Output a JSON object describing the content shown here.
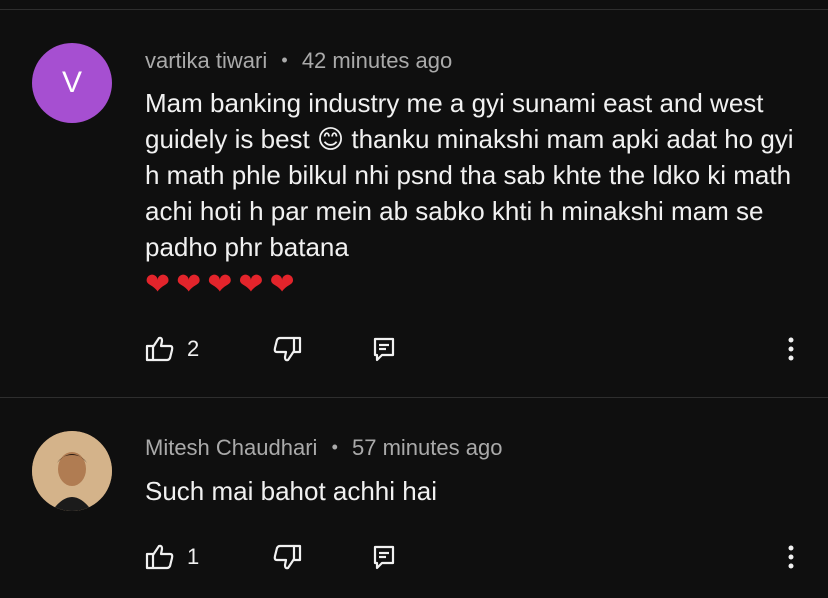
{
  "comments": [
    {
      "avatar_letter": "V",
      "author": "vartika tiwari",
      "separator": "•",
      "time": "42 minutes ago",
      "text_part1": "Mam banking industry me a gyi sunami east and west guidely is best",
      "emoji": "😊",
      "text_part2": "thanku minakshi mam apki adat ho gyi h math phle bilkul nhi psnd tha sab khte the ldko ki math achi hoti h par mein ab sabko khti h minakshi mam se padho phr batana",
      "hearts": "❤❤❤❤❤",
      "likes": "2"
    },
    {
      "author": "Mitesh Chaudhari",
      "separator": "•",
      "time": "57 minutes ago",
      "text": "Such mai bahot achhi hai",
      "likes": "1"
    }
  ],
  "colors": {
    "background": "#0f0f0f",
    "avatar_purple": "#a64fd1",
    "meta_gray": "#aaaaaa",
    "text": "#f1f1f1"
  }
}
